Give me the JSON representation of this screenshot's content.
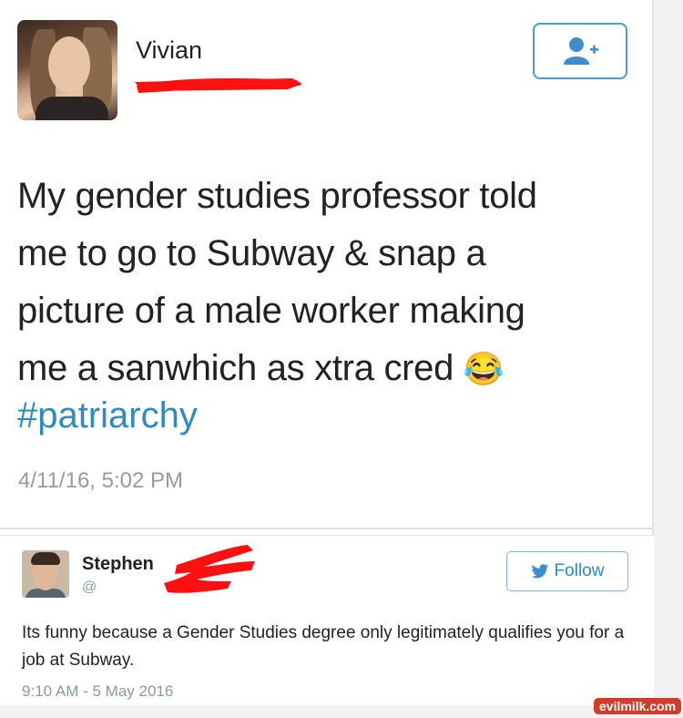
{
  "tweet": {
    "author_name": "Vivian",
    "lines": [
      "My gender studies professor told",
      "me to go to Subway & snap a",
      "picture of a male worker making",
      "me a sanwhich as xtra cred"
    ],
    "emoji": "😂",
    "hashtag": "#patriarchy",
    "timestamp": "4/11/16, 5:02 PM"
  },
  "reply": {
    "author_name": "Stephen",
    "handle": "@",
    "follow_label": "Follow",
    "text": "Its funny because a Gender Studies degree only legitimately qualifies you for a job at Subway.",
    "timestamp": "9:10 AM - 5 May 2016"
  },
  "watermark": "evilmilk.com",
  "colors": {
    "link_blue": "#2b8cc4",
    "button_border": "#4a9bd8",
    "redaction_red": "#ff1010",
    "timestamp_gray": "#9a9a9a"
  },
  "icons": {
    "follow_icon": "add-user-icon",
    "bird": "twitter-bird-icon"
  }
}
